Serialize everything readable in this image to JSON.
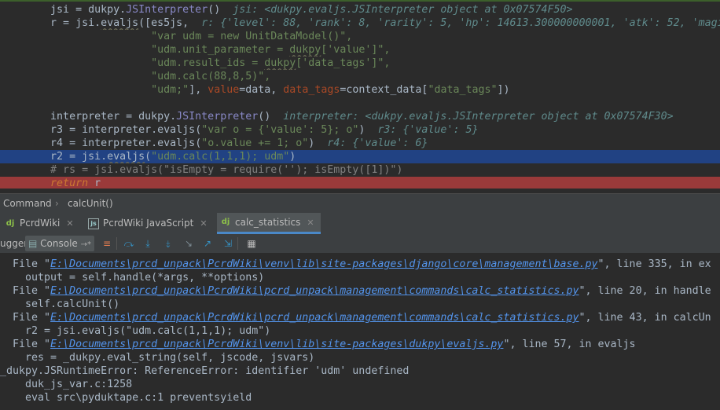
{
  "editor": {
    "line1": {
      "code_a": "jsi = dukpy.",
      "cls": "JSInterpreter",
      "code_b": "()  ",
      "hint": "jsi: <dukpy.evaljs.JSInterpreter object at 0x07574F50>"
    },
    "line2": {
      "code_a": "r = jsi.",
      "fn": "evaljs",
      "code_b": "([es5js,  ",
      "hint": "r: {'level': 88, 'rank': 8, 'rarity': 5, 'hp': 14613.300000000001, 'atk': 52, 'magi"
    },
    "line3": {
      "str": "\"var udm = new UnitDataModel()\","
    },
    "line4": {
      "str_a": "\"udm.unit_parameter = ",
      "ul": "dukpy",
      "str_b": "['value']\","
    },
    "line5": {
      "str_a": "\"udm.result_ids = ",
      "ul": "dukpy",
      "str_b": "['data_tags']\","
    },
    "line6": {
      "str": "\"udm.calc(88,8,5)\","
    },
    "line7": {
      "str": "\"udm;\"",
      "code_a": "], ",
      "param1": "value",
      "code_b": "=data, ",
      "param2": "data_tags",
      "code_c": "=context_data[",
      "str2": "\"data_tags\"",
      "code_d": "])"
    },
    "line8": {
      "code_a": "interpreter = dukpy.",
      "cls": "JSInterpreter",
      "code_b": "()  ",
      "hint": "interpreter: <dukpy.evaljs.JSInterpreter object at 0x07574F30>"
    },
    "line9": {
      "code_a": "r3 = interpreter.",
      "fn": "evaljs",
      "code_b": "(",
      "str": "\"var o = {'value': 5}; o\"",
      "code_c": ")  ",
      "hint": "r3: {'value': 5}"
    },
    "line10": {
      "code_a": "r4 = interpreter.",
      "fn": "evaljs",
      "code_b": "(",
      "str": "\"o.value += 1; o\"",
      "code_c": ")  ",
      "hint": "r4: {'value': 6}"
    },
    "line11": {
      "code_a": "r2 = jsi.",
      "fn": "evaljs",
      "code_b": "(",
      "str": "\"udm.calc(1,1,1); udm\"",
      "code_c": ")"
    },
    "line12": {
      "comment": "# rs = jsi.evaljs(\"isEmpty = require(''); isEmpty([1])\")"
    },
    "line13": {
      "kw": "return",
      "code": " r"
    }
  },
  "breadcrumb": {
    "first": "Command",
    "sep": "›",
    "second": "calcUnit()"
  },
  "tabs": [
    {
      "label": "PcrdWiki",
      "icon": "dj"
    },
    {
      "label": "PcrdWiki JavaScript",
      "icon": "js"
    },
    {
      "label": "calc_statistics",
      "icon": "dj"
    }
  ],
  "toolbar": {
    "debugger_label": "ugger",
    "console_label": "Console",
    "console_arrow": "→*"
  },
  "console": {
    "l1": {
      "pre": "  File \"",
      "link": "E:\\Documents\\prcd_unpack\\PcrdWiki\\venv\\lib\\site-packages\\django\\core\\management\\base.py",
      "post": "\", line 335, in ex"
    },
    "l2": {
      "text": "    output = self.handle(*args, **options)"
    },
    "l3": {
      "pre": "  File \"",
      "link": "E:\\Documents\\prcd_unpack\\PcrdWiki\\pcrd_unpack\\management\\commands\\calc_statistics.py",
      "post": "\", line 20, in handle"
    },
    "l4": {
      "text": "    self.calcUnit()"
    },
    "l5": {
      "pre": "  File \"",
      "link": "E:\\Documents\\prcd_unpack\\PcrdWiki\\pcrd_unpack\\management\\commands\\calc_statistics.py",
      "post": "\", line 43, in calcUn"
    },
    "l6": {
      "text": "    r2 = jsi.evaljs(\"udm.calc(1,1,1); udm\")"
    },
    "l7": {
      "pre": "  File \"",
      "link": "E:\\Documents\\prcd_unpack\\PcrdWiki\\venv\\lib\\site-packages\\dukpy\\evaljs.py",
      "post": "\", line 57, in evaljs"
    },
    "l8": {
      "text": "    res = _dukpy.eval_string(self, jscode, jsvars)"
    },
    "l9": {
      "text": "_dukpy.JSRuntimeError: ReferenceError: identifier 'udm' undefined"
    },
    "l10": {
      "text": "    duk_js_var.c:1258"
    },
    "l11": {
      "text": "    eval src\\pyduktape.c:1 preventsyield"
    }
  }
}
